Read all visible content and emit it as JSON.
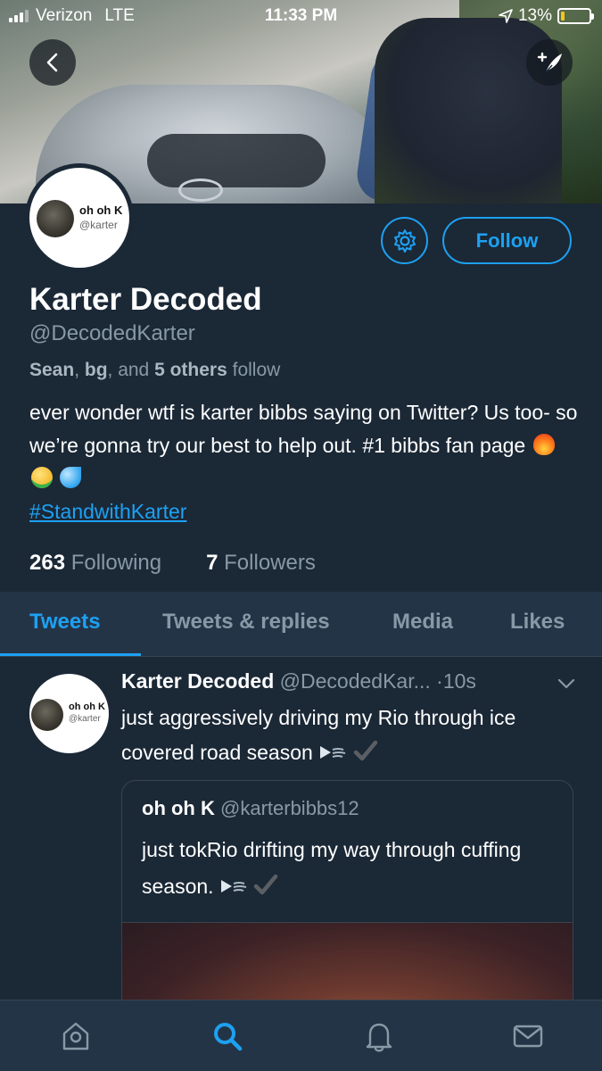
{
  "status_bar": {
    "carrier": "Verizon",
    "network": "LTE",
    "time": "11:33 PM",
    "battery_percent": "13%",
    "battery_level": 0.13
  },
  "profile": {
    "avatar_name": "oh oh K",
    "avatar_handle": "@karter",
    "display_name": "Karter Decoded",
    "handle": "@DecodedKarter",
    "follow_context": {
      "name1": "Sean",
      "sep1": ", ",
      "name2": "bg",
      "sep2": ", and ",
      "others": "5 others",
      "suffix": " follow"
    },
    "bio_text": "ever wonder wtf is karter bibbs saying on Twitter? Us too- so we’re gonna try our best to help out. #1 bibbs fan page",
    "bio_hashtag": "#StandwithKarter",
    "following_count": "263",
    "following_label": "Following",
    "followers_count": "7",
    "followers_label": "Followers",
    "follow_button": "Follow"
  },
  "tabs": [
    {
      "label": "Tweets",
      "active": true
    },
    {
      "label": "Tweets & replies",
      "active": false
    },
    {
      "label": "Media",
      "active": false
    },
    {
      "label": "Likes",
      "active": false
    }
  ],
  "tweet": {
    "avatar_name": "oh oh K",
    "avatar_handle": "@karter",
    "name": "Karter Decoded",
    "handle": "@DecodedKar...",
    "time": "·10s",
    "text": "just aggressively driving my Rio through ice covered road season",
    "quote": {
      "name": "oh oh K",
      "handle": "@karterbibbs12",
      "text": "just tokRio drifting my way through cuffing season."
    }
  },
  "icons": {
    "back": "chevron-left-icon",
    "compose": "compose-tweet-icon",
    "settings": "gear-icon",
    "nav": [
      "home-icon",
      "search-icon",
      "notifications-bell-icon",
      "messages-envelope-icon"
    ]
  },
  "colors": {
    "background": "#1b2836",
    "accent": "#1da1f2",
    "secondary_text": "#8899a6",
    "tab_bar": "#243447"
  }
}
